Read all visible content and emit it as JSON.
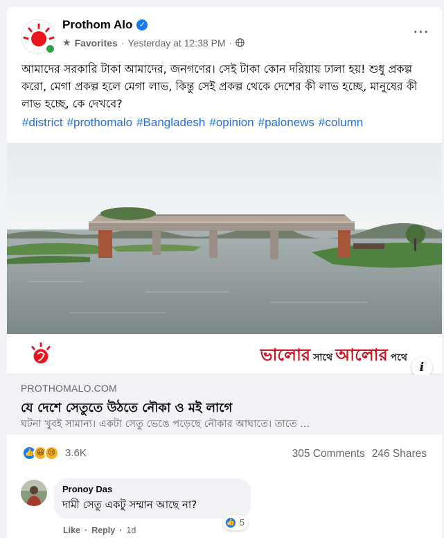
{
  "post": {
    "page_name": "Prothom Alo",
    "audience": "Favorites",
    "timestamp": "Yesterday at 12:38 PM",
    "privacy_icon": "globe-icon",
    "more_icon": "more-options-icon",
    "text": "আমাদের সরকারি টাকা আমাদের, জনগণের। সেই টাকা কোন দরিয়ায় ঢালা হয়! শুধু প্রকল্প করো, মেগা প্রকল্প হলে মেগা লাভ, কিন্তু সেই প্রকল্প থেকে দেশের কী লাভ হচ্ছে, মানুষের কী লাভ হচ্ছে, কে দেখবে?",
    "hashtags": [
      "#district",
      "#prothomalo",
      "#Bangladesh",
      "#opinion",
      "#palonews",
      "#column"
    ]
  },
  "link_preview": {
    "banner_tagline_1": "ভালোর",
    "banner_tagline_small_1": "সাথে",
    "banner_tagline_2": "আলোর",
    "banner_tagline_small_2": "পথে",
    "info_label": "i",
    "domain": "PROTHOMALO.COM",
    "title": "যে দেশে সেতুতে উঠতে নৌকা ও মই লাগে",
    "description": "ঘটনা খুবই সামান্য। একটা সেতু ভেঙে পড়েছে নৌকার আঘাতে। তাতে ..."
  },
  "engagement": {
    "reaction_count": "3.6K",
    "comments": "305 Comments",
    "shares": "246 Shares"
  },
  "comment": {
    "author": "Pronoy Das",
    "text": "দামী সেতু একটু সম্মান আছে না?",
    "like_count": "5",
    "like_label": "Like",
    "reply_label": "Reply",
    "time": "1d"
  },
  "colors": {
    "brand_red": "#e8151f",
    "link_blue": "#216fdb",
    "like_blue": "#1877f2"
  }
}
